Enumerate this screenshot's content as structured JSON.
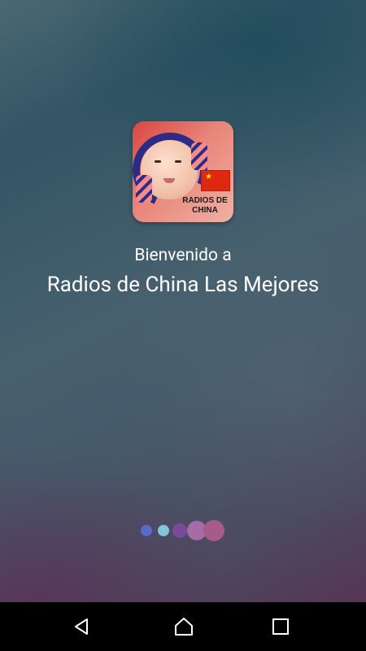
{
  "app_icon": {
    "name": "radio-baby-headphones-icon",
    "text": "RADIOS DE CHINA",
    "flag": "china-flag"
  },
  "welcome_text": "Bienvenido a",
  "app_name": "Radios de China Las Mejores",
  "loader": {
    "dot_colors": [
      "#5a68c8",
      "#84c6d6",
      "#7a4a9a",
      "#a86ba8",
      "#a85a88"
    ]
  },
  "navbar": {
    "back_icon": "back-triangle",
    "home_icon": "home",
    "recent_icon": "recent-square"
  }
}
